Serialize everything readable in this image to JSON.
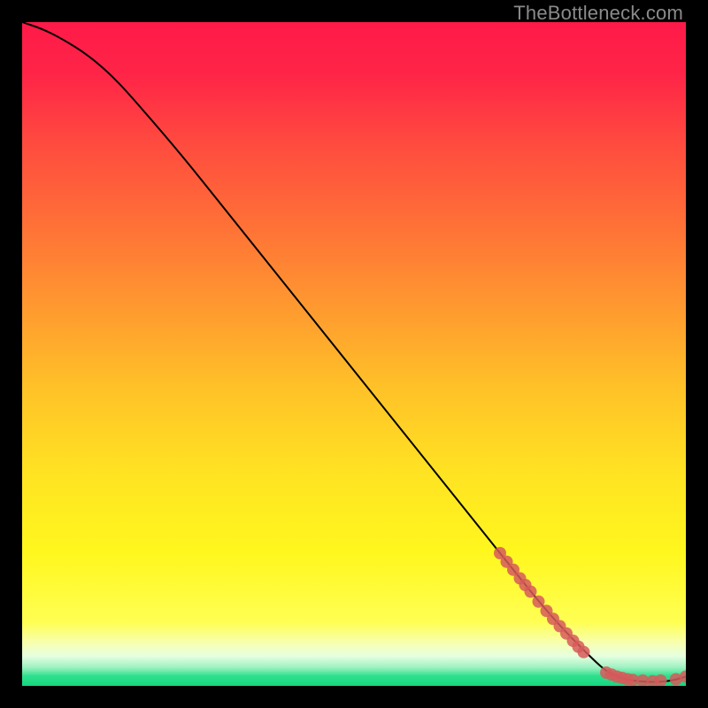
{
  "watermark": "TheBottleneck.com",
  "chart_data": {
    "type": "line",
    "title": "",
    "xlabel": "",
    "ylabel": "",
    "xlim": [
      0,
      100
    ],
    "ylim": [
      0,
      100
    ],
    "grid": false,
    "series": [
      {
        "name": "curve",
        "color": "#000000",
        "x": [
          0,
          3,
          6,
          10,
          14,
          18,
          24,
          30,
          36,
          42,
          48,
          54,
          60,
          66,
          72,
          78,
          82,
          86,
          88,
          90,
          92,
          94,
          96,
          98,
          100
        ],
        "y": [
          100,
          99,
          97.5,
          95,
          91.5,
          87,
          80,
          72.5,
          65,
          57.5,
          50,
          42.5,
          35,
          27.5,
          20,
          12.5,
          8,
          4,
          2.2,
          1.2,
          0.8,
          0.6,
          0.6,
          0.8,
          1.4
        ]
      }
    ],
    "markers": [
      {
        "name": "cluster-diagonal",
        "color": "#d65a5a",
        "points": [
          {
            "x": 72,
            "y": 20
          },
          {
            "x": 73,
            "y": 18.7
          },
          {
            "x": 74,
            "y": 17.5
          },
          {
            "x": 75,
            "y": 16.2
          },
          {
            "x": 75.8,
            "y": 15.2
          },
          {
            "x": 76.6,
            "y": 14.2
          },
          {
            "x": 77.8,
            "y": 12.7
          },
          {
            "x": 79,
            "y": 11.3
          },
          {
            "x": 80,
            "y": 10.1
          },
          {
            "x": 81,
            "y": 9
          },
          {
            "x": 82,
            "y": 7.9
          },
          {
            "x": 83,
            "y": 6.8
          },
          {
            "x": 83.8,
            "y": 5.9
          },
          {
            "x": 84.6,
            "y": 5.1
          }
        ]
      },
      {
        "name": "cluster-floor",
        "color": "#d65a5a",
        "points": [
          {
            "x": 88,
            "y": 2.0
          },
          {
            "x": 88.8,
            "y": 1.7
          },
          {
            "x": 89.6,
            "y": 1.4
          },
          {
            "x": 90.4,
            "y": 1.2
          },
          {
            "x": 91.2,
            "y": 1.0
          },
          {
            "x": 92,
            "y": 0.9
          },
          {
            "x": 93.5,
            "y": 0.8
          },
          {
            "x": 95,
            "y": 0.7
          },
          {
            "x": 96.2,
            "y": 0.8
          },
          {
            "x": 98.5,
            "y": 1.0
          },
          {
            "x": 100,
            "y": 1.4
          }
        ]
      }
    ],
    "background_gradient": {
      "stops": [
        {
          "pos": 0.0,
          "color": "#ff1a49"
        },
        {
          "pos": 0.08,
          "color": "#ff2547"
        },
        {
          "pos": 0.18,
          "color": "#ff4a3f"
        },
        {
          "pos": 0.3,
          "color": "#ff6f37"
        },
        {
          "pos": 0.42,
          "color": "#ff9630"
        },
        {
          "pos": 0.55,
          "color": "#ffc128"
        },
        {
          "pos": 0.68,
          "color": "#ffe322"
        },
        {
          "pos": 0.8,
          "color": "#fff71e"
        },
        {
          "pos": 0.905,
          "color": "#ffff54"
        },
        {
          "pos": 0.935,
          "color": "#f7ffb0"
        },
        {
          "pos": 0.955,
          "color": "#e6ffe0"
        },
        {
          "pos": 0.972,
          "color": "#9ff2c1"
        },
        {
          "pos": 0.985,
          "color": "#2fe08e"
        },
        {
          "pos": 1.0,
          "color": "#15d67f"
        }
      ]
    }
  }
}
